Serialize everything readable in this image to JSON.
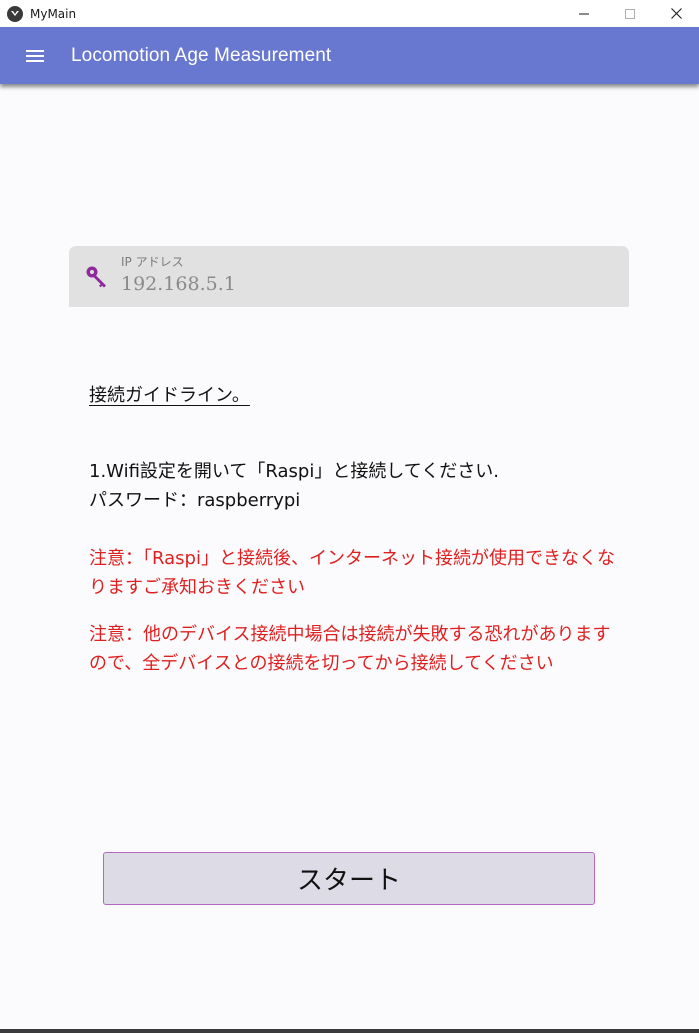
{
  "window": {
    "title": "MyMain",
    "icon": "app-logo-icon",
    "controls": [
      "minimize-icon",
      "maximize-icon",
      "close-icon"
    ]
  },
  "appbar": {
    "menu_icon": "hamburger-menu-icon",
    "title": "Locomotion Age Measurement",
    "color": "#6878d0"
  },
  "ip_field": {
    "icon": "key-icon",
    "label": "IP アドレス",
    "value": "192.168.5.1",
    "icon_color": "#8e2a9c"
  },
  "guide": {
    "heading": "接続ガイドライン。",
    "step1_line1": "1.Wifi設定を開いて「Raspi」と接続してください.",
    "step1_line2": "パスワード：raspberrypi",
    "warning1": "注意：「Raspi」と接続後、インターネット接続が使用できなくなりますご承知おきください",
    "warning2": "注意：他のデバイス接続中場合は接続が失敗する恐れがありますので、全デバイスとの接続を切ってから接続してください",
    "warning_color": "#e02020"
  },
  "start_button": {
    "label": "スタート"
  }
}
